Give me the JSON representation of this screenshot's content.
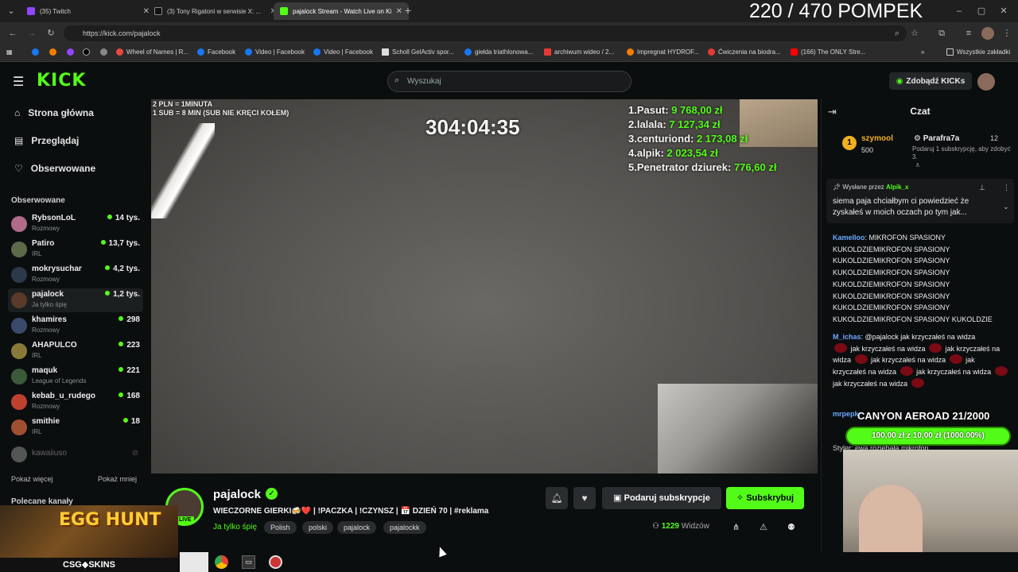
{
  "overlay": {
    "pushups": "220 / 470 POMPEK"
  },
  "tabs": [
    {
      "label": "(35) Twitch",
      "color": "#9146ff"
    },
    {
      "label": "(3) Tony Rigatoni w serwisie X: ...",
      "color": "#111111"
    },
    {
      "label": "pajalock Stream - Watch Live on Kick",
      "color": "#53fc18"
    }
  ],
  "browser": {
    "url": "https://kick.com/pajalock"
  },
  "bookmarks": [
    {
      "label": "Wheel of Names | R...",
      "color": "#e84b3c"
    },
    {
      "label": "Facebook",
      "color": "#1877f2"
    },
    {
      "label": "Video | Facebook",
      "color": "#1877f2"
    },
    {
      "label": "Video | Facebook",
      "color": "#1877f2"
    },
    {
      "label": "Scholl GelActiv spor...",
      "color": "#dddddd"
    },
    {
      "label": "giełda triathlonowa...",
      "color": "#1877f2"
    },
    {
      "label": "archiwum wideo / 2...",
      "color": "#e53935"
    },
    {
      "label": "Impregnat HYDROF...",
      "color": "#f57c00"
    },
    {
      "label": "Ćwiczenia na biodra...",
      "color": "#e53935"
    },
    {
      "label": "(166) The ONLY Stre...",
      "color": "#ff0000"
    },
    {
      "label": "Wszystkie zakładki",
      "color": "#999999"
    }
  ],
  "header": {
    "search_placeholder": "Wyszukaj",
    "kicks_label": "Zdobądź KICKs",
    "logo": "KICK"
  },
  "sidebar": {
    "nav": [
      {
        "label": "Strona główna",
        "icon": "home-icon"
      },
      {
        "label": "Przeglądaj",
        "icon": "browse-icon"
      },
      {
        "label": "Obserwowane",
        "icon": "heart-icon"
      }
    ],
    "followed_title": "Obserwowane",
    "channels": [
      {
        "name": "RybsonLoL",
        "category": "Rozmowy",
        "viewers": "14 tys.",
        "color": "#b06a8a"
      },
      {
        "name": "Patiro",
        "category": "IRL",
        "viewers": "13,7 tys.",
        "color": "#5d6a4a"
      },
      {
        "name": "mokrysuchar",
        "category": "Rozmowy",
        "viewers": "4,2 tys.",
        "color": "#2a3a4a"
      },
      {
        "name": "pajalock",
        "category": "Ja tylko śpię",
        "viewers": "1,2 tys.",
        "color": "#5a3a2a"
      },
      {
        "name": "khamires",
        "category": "Rozmowy",
        "viewers": "298",
        "color": "#3a4a6a"
      },
      {
        "name": "AHAPULCO",
        "category": "IRL",
        "viewers": "223",
        "color": "#8a7a3a"
      },
      {
        "name": "maquk",
        "category": "League of Legends",
        "viewers": "221",
        "color": "#3a5a3a"
      },
      {
        "name": "kebab_u_rudego",
        "category": "Rozmowy",
        "viewers": "168",
        "color": "#c04030"
      },
      {
        "name": "smithie",
        "category": "IRL",
        "viewers": "18",
        "color": "#a05030"
      }
    ],
    "offline_channel": "kawaiiuso",
    "show_more": "Pokaż więcej",
    "show_less": "Pokaż mniej",
    "recommended_title": "Polecane kanały"
  },
  "video": {
    "top_note_1": "2 PLN = 1MINUTA",
    "top_note_2": "1 SUB = 8 MIN (SUB NIE KRĘCI KOŁEM)",
    "timer": "304:04:35",
    "leaderboard": [
      {
        "rank_name": "1.Pasut:",
        "amount": "9 768,00 zł"
      },
      {
        "rank_name": "2.lalala:",
        "amount": "7 127,34 zł"
      },
      {
        "rank_name": "3.centuriond:",
        "amount": "2 173,08 zł"
      },
      {
        "rank_name": "4.alpik:",
        "amount": "2 023,54 zł"
      },
      {
        "rank_name": "5.Penetrator dziurek:",
        "amount": "776,60 zł"
      }
    ]
  },
  "stream": {
    "channel": "pajalock",
    "title": "WIECZORNE GIERKI🍻❤️ | !PACZKA | !CZYNSZ | 📅 DZIEŃ 70 | #reklama",
    "category": "Ja tylko śpię",
    "live": "LIVE",
    "tags": [
      "Polish",
      "polski",
      "pajalock",
      "pajalockk"
    ],
    "gift_label": "Podaruj subskrypcje",
    "subscribe_label": "Subskrybuj",
    "viewers": "1229",
    "viewers_label": "Widzów"
  },
  "chat": {
    "title": "Czat",
    "gifters": [
      {
        "name": "szymool",
        "count": "500",
        "rank": "1"
      },
      {
        "name": "Parafra7a",
        "count": "12",
        "note": "Podaruj 1 subskrypcję, aby zdobyć 3."
      }
    ],
    "pinned_by_label": "Wysłane przez",
    "pinned_by_user": "Alpik_x",
    "pinned_text": "siema paja chciałbym ci powiedzieć że zyskałeś w moich oczach po tym jak...",
    "messages": [
      {
        "user": "Kamelloo",
        "color": "#6ea8ff",
        "text": "MIKROFON SPASIONY KUKOLDZIEMIKROFON SPASIONY KUKOLDZIEMIKROFON SPASIONY KUKOLDZIEMIKROFON SPASIONY KUKOLDZIEMIKROFON SPASIONY KUKOLDZIEMIKROFON SPASIONY KUKOLDZIEMIKROFON SPASIONY KUKOLDZIEMIKROFON SPASIONY KUKOLDZIE"
      },
      {
        "user": "M_ichas",
        "color": "#6ea8ff",
        "text": "@pajalock jak krzyczałeś na widza"
      }
    ],
    "emote_line": "jak krzyczałeś na widza",
    "partial_user": "mrpepk",
    "partial_line": "Styler: ewa rozjebała mikrofon"
  },
  "goal": {
    "label": "CANYON AEROAD 21/2000",
    "progress": "100,00 zł z 10,00 zł (1000.00%)"
  },
  "promo": {
    "title": "EGG HUNT",
    "brand": "CSG◆SKINS"
  }
}
